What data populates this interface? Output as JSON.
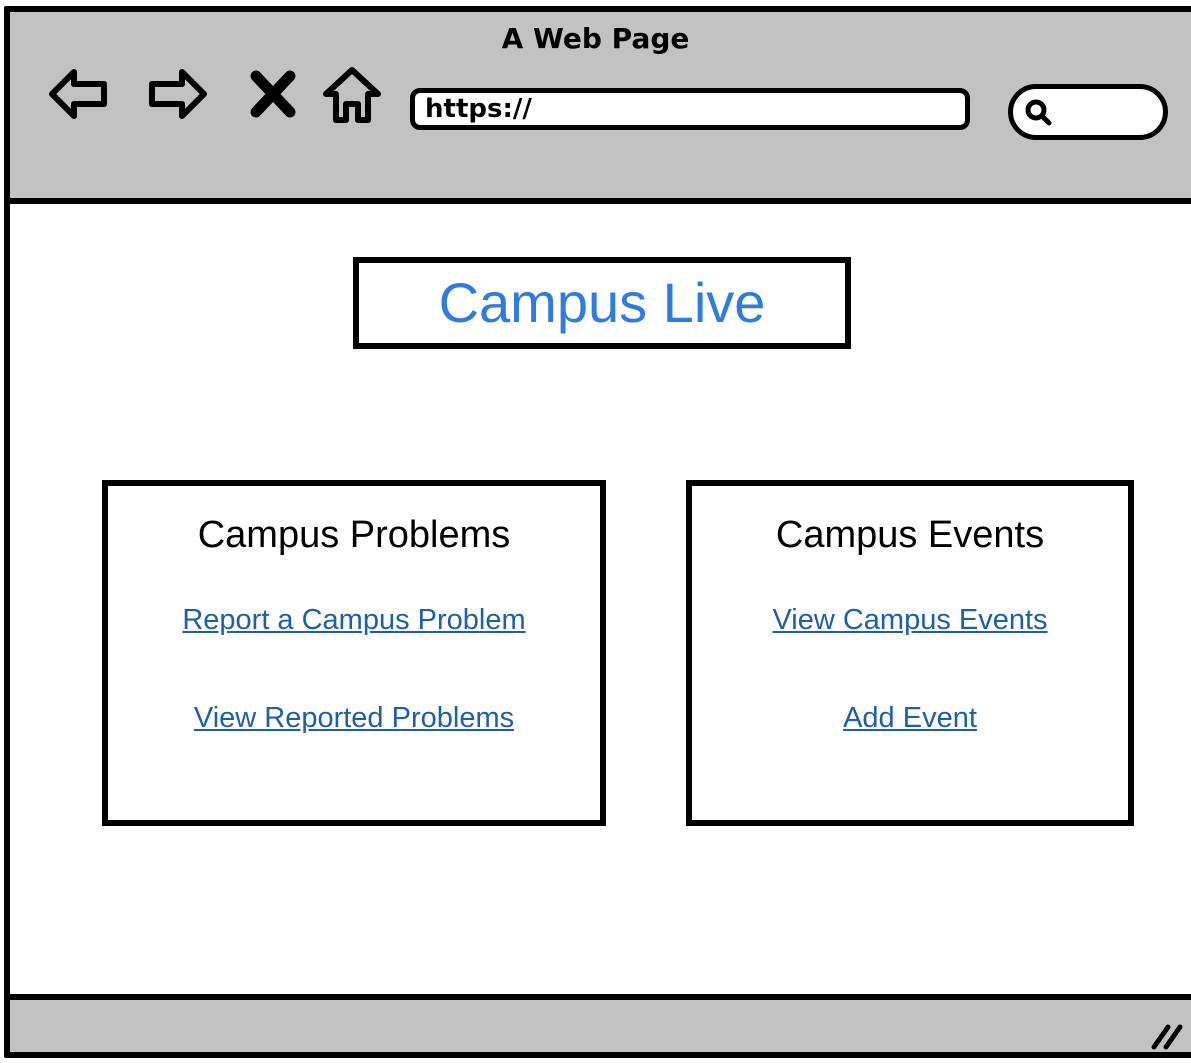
{
  "window": {
    "title": "A Web Page"
  },
  "toolbar": {
    "icons": [
      "back-arrow-icon",
      "forward-arrow-icon",
      "close-icon",
      "home-icon"
    ],
    "url_value": "https://",
    "search_icon": "search-icon"
  },
  "page": {
    "brand_title": "Campus Live",
    "brand_color": "#2f7be0",
    "link_color": "#1f5fa8",
    "cards": [
      {
        "title": "Campus Problems",
        "links": [
          "Report a Campus Problem",
          "View Reported Problems"
        ]
      },
      {
        "title": "Campus Events",
        "links": [
          "View Campus Events",
          "Add Event"
        ]
      }
    ]
  },
  "footer": {
    "grip_icon": "resize-grip-icon"
  }
}
